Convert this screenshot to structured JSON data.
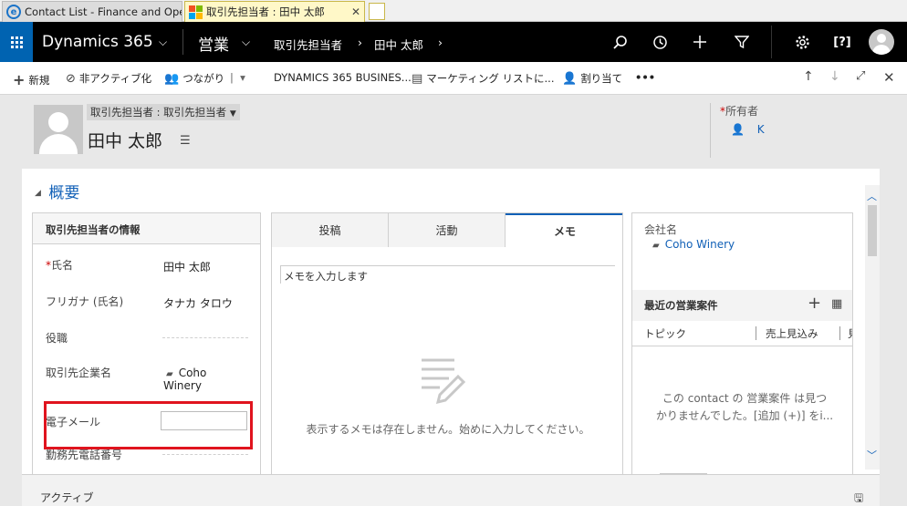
{
  "browser": {
    "tabs": [
      {
        "title": "Contact List - Finance and Ope..."
      },
      {
        "title": "取引先担当者 : 田中 太郎"
      }
    ]
  },
  "nav": {
    "brand": "Dynamics 365",
    "area": "営業",
    "crumb_entity": "取引先担当者",
    "crumb_record": "田中 太郎"
  },
  "commands": {
    "new": "新規",
    "deactivate": "非アクティブ化",
    "connect": "つながり",
    "business": "DYNAMICS 365 BUSINES...",
    "marketing": "マーケティング リストに...",
    "assign": "割り当て",
    "more": "•••"
  },
  "header": {
    "form_selector": "取引先担当者 : 取引先担当者",
    "record_name": "田中 太郎",
    "owner_label": "所有者",
    "owner_value": "K"
  },
  "section": {
    "title": "概要"
  },
  "contact_info": {
    "title": "取引先担当者の情報",
    "fields": [
      {
        "label": "氏名",
        "value": "田中 太郎"
      },
      {
        "label": "フリガナ (氏名)",
        "value": "タナカ タロウ"
      },
      {
        "label": "役職",
        "value": ""
      },
      {
        "label": "取引先企業名",
        "value_line1": "Coho",
        "value_line2": "Winery"
      },
      {
        "label": "電子メール",
        "value": ""
      },
      {
        "label": "勤務先電話番号",
        "value": ""
      }
    ]
  },
  "social": {
    "tabs": [
      "投稿",
      "活動",
      "メモ"
    ],
    "note_placeholder": "メモを入力します",
    "empty_message": "表示するメモは存在しません。始めに入力してください。"
  },
  "related": {
    "company_label": "会社名",
    "company_value": "Coho Winery",
    "opp_title": "最近の営業案件",
    "opp_columns": [
      "トピック",
      "売上見込み",
      "見"
    ],
    "opp_empty_line1": "この contact の 営業案件 は見つ",
    "opp_empty_line2": "かりませんでした。[追加 (+)] をі..."
  },
  "footer": {
    "status": "アクティブ"
  },
  "colors": {
    "nav_bg": "#000000",
    "waffle_bg": "#0063b1",
    "link": "#1160b7",
    "highlight": "#e0141e"
  }
}
